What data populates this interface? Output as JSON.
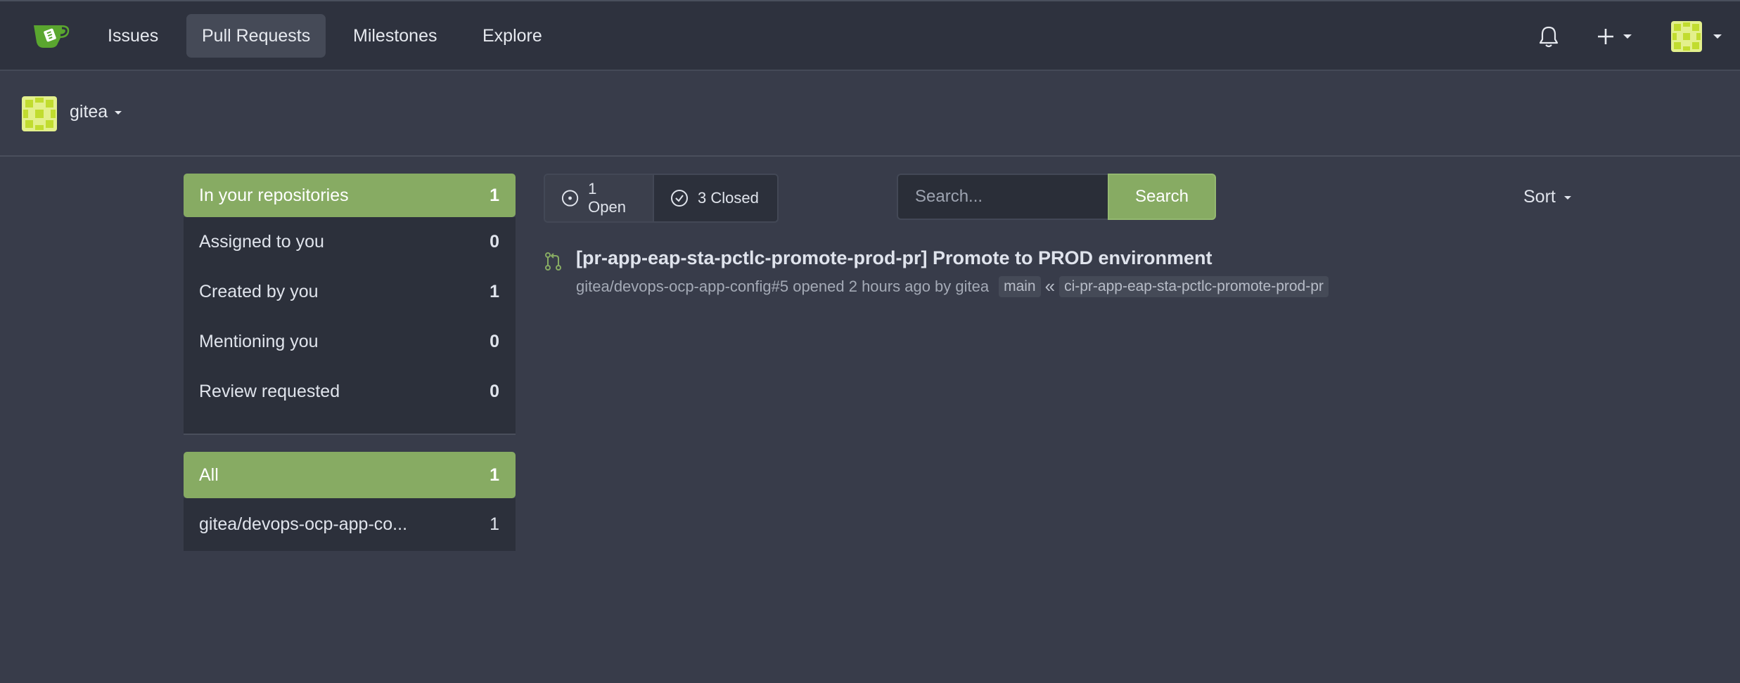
{
  "nav": {
    "items": [
      {
        "label": "Issues",
        "active": false
      },
      {
        "label": "Pull Requests",
        "active": true
      },
      {
        "label": "Milestones",
        "active": false
      },
      {
        "label": "Explore",
        "active": false
      }
    ],
    "right_icons": [
      "bell-icon",
      "plus-icon",
      "avatar"
    ]
  },
  "context": {
    "user": "gitea"
  },
  "sidebar": {
    "filters": [
      {
        "label": "In your repositories",
        "count": "1",
        "active": true
      },
      {
        "label": "Assigned to you",
        "count": "0"
      },
      {
        "label": "Created by you",
        "count": "1"
      },
      {
        "label": "Mentioning you",
        "count": "0"
      },
      {
        "label": "Review requested",
        "count": "0"
      }
    ],
    "repos": [
      {
        "label": "All",
        "count": "1",
        "active": true
      },
      {
        "label": "gitea/devops-ocp-app-co...",
        "count": "1"
      }
    ]
  },
  "state": {
    "open": "1 Open",
    "closed": "3 Closed"
  },
  "search": {
    "placeholder": "Search...",
    "button": "Search"
  },
  "sort": {
    "label": "Sort"
  },
  "issues": [
    {
      "title": "[pr-app-eap-sta-pctlc-promote-prod-pr] Promote to PROD environment",
      "meta": "gitea/devops-ocp-app-config#5 opened 2 hours ago by gitea",
      "base_branch": "main",
      "head_branch": "ci-pr-app-eap-sta-pctlc-promote-prod-pr"
    }
  ],
  "colors": {
    "accent": "#87ab63",
    "background": "#383c4a",
    "navbar": "#2e323e"
  }
}
